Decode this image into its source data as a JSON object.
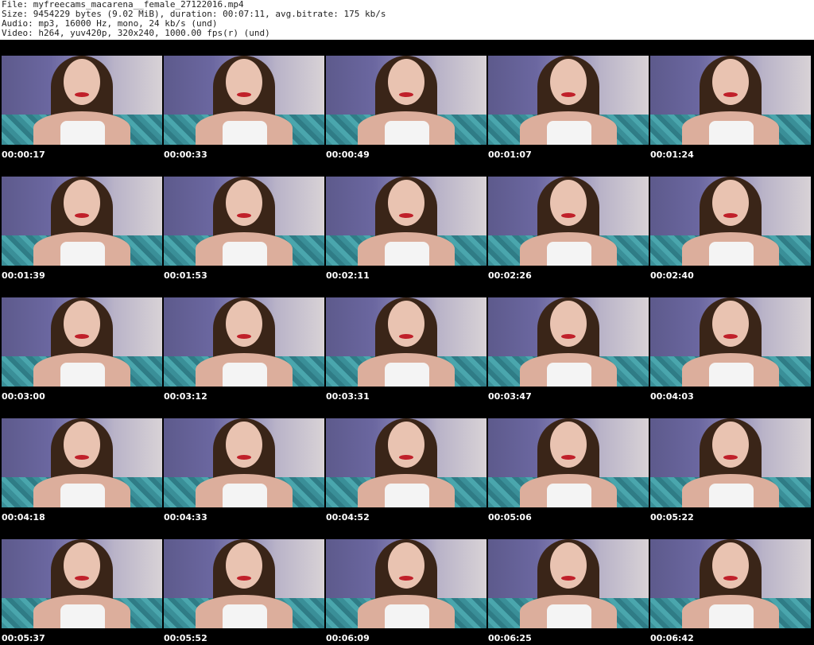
{
  "meta": {
    "file": "File: myfreecams_macarena__female_27122016.mp4",
    "size": "Size: 9454229 bytes (9.02 MiB), duration: 00:07:11, avg.bitrate: 175 kb/s",
    "audio": "Audio: mp3, 16000 Hz, mono, 24 kb/s (und)",
    "video": "Video: h264, yuv420p, 320x240, 1000.00 fps(r) (und)"
  },
  "thumbnails": [
    "00:00:17",
    "00:00:33",
    "00:00:49",
    "00:01:07",
    "00:01:24",
    "00:01:39",
    "00:01:53",
    "00:02:11",
    "00:02:26",
    "00:02:40",
    "00:03:00",
    "00:03:12",
    "00:03:31",
    "00:03:47",
    "00:04:03",
    "00:04:18",
    "00:04:33",
    "00:04:52",
    "00:05:06",
    "00:05:22",
    "00:05:37",
    "00:05:52",
    "00:06:09",
    "00:06:25",
    "00:06:42"
  ]
}
